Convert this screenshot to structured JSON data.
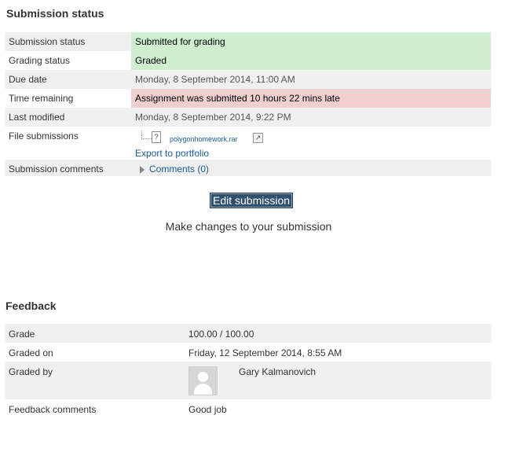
{
  "submission": {
    "heading": "Submission status",
    "rows": {
      "submission_status": {
        "label": "Submission status",
        "value": "Submitted for grading"
      },
      "grading_status": {
        "label": "Grading status",
        "value": "Graded"
      },
      "due_date": {
        "label": "Due date",
        "value": "Monday, 8 September 2014, 11:00 AM"
      },
      "time_remaining": {
        "label": "Time remaining",
        "value": "Assignment was submitted 10 hours 22 mins late"
      },
      "last_modified": {
        "label": "Last modified",
        "value": "Monday, 8 September 2014, 9:22 PM"
      },
      "file_submissions": {
        "label": "File submissions",
        "file_name": "polygonhomework.rar",
        "export_link": "Export to portfolio"
      },
      "submission_comments": {
        "label": "Submission comments",
        "toggle": "Comments (0)"
      }
    },
    "edit_button": "Edit submission",
    "edit_help": "Make changes to your submission"
  },
  "feedback": {
    "heading": "Feedback",
    "rows": {
      "grade": {
        "label": "Grade",
        "value": "100.00 / 100.00"
      },
      "graded_on": {
        "label": "Graded on",
        "value": "Friday, 12 September 2014, 8:55 AM"
      },
      "graded_by": {
        "label": "Graded by",
        "value": "Gary Kalmanovich"
      },
      "feedback_comments": {
        "label": "Feedback comments",
        "value": "Good job"
      }
    }
  },
  "icons": {
    "file": "unknown-file-icon",
    "portfolio": "portfolio-export-icon",
    "comments": "expand-caret-icon",
    "avatar": "default-user-avatar"
  },
  "colors": {
    "submitted": "#cfefcf",
    "late": "#efcfcf",
    "link": "#1a5c99",
    "button": "#2f4f6f"
  }
}
